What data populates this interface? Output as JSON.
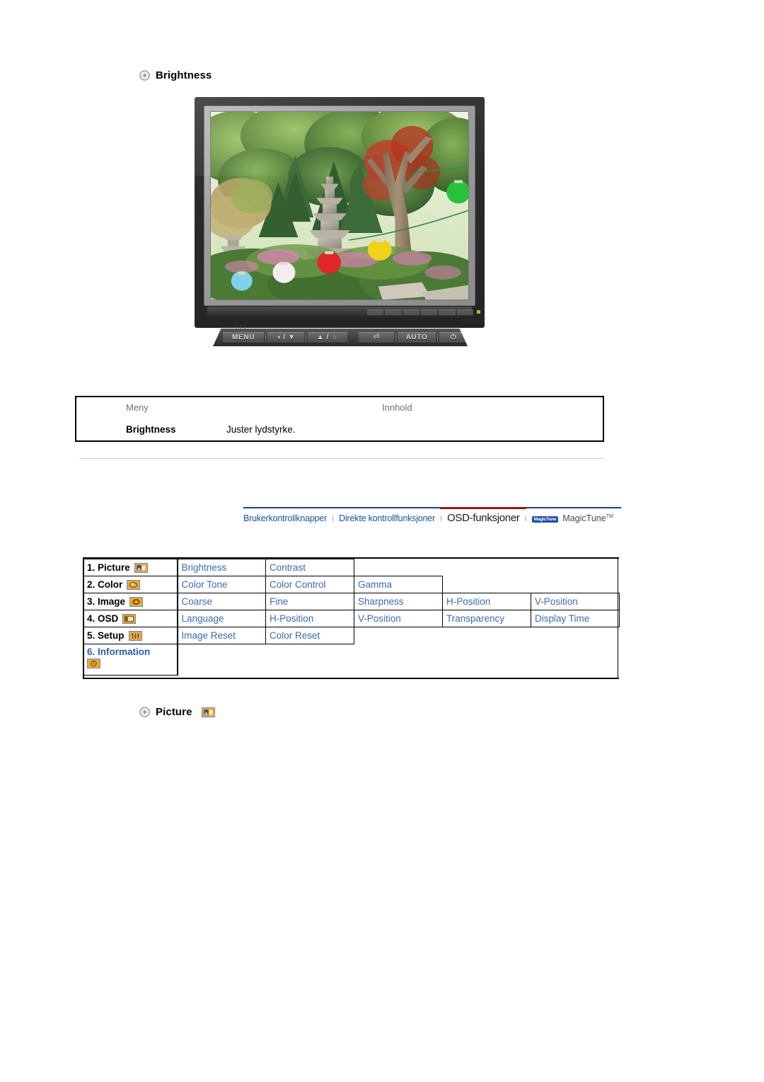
{
  "page": {
    "heading_brightness": "Brightness",
    "heading_picture": "Picture"
  },
  "monitor": {
    "controls": [
      {
        "name": "menu-button",
        "label": "MENU"
      },
      {
        "name": "brightness-down-button",
        "label": "◑ / ▼"
      },
      {
        "name": "brightness-up-button",
        "label": "▲ / ☼"
      },
      {
        "name": "enter-button",
        "label": "⏎"
      },
      {
        "name": "auto-button",
        "label": "AUTO"
      },
      {
        "name": "power-button",
        "label": "⏻"
      }
    ],
    "menu_mark": "|||"
  },
  "meny_table": {
    "headers": {
      "menu": "Meny",
      "content": "Innhold"
    },
    "rows": [
      {
        "menu": "Brightness",
        "content": "Juster lydstyrke."
      }
    ]
  },
  "tab_nav": {
    "items": [
      {
        "label": "Brukerkontrollknapper",
        "active": false
      },
      {
        "label": "Direkte kontrollfunksjoner",
        "active": false
      },
      {
        "label": "OSD-funksjoner",
        "active": true
      }
    ],
    "separator": "I",
    "magictune_badge": "MagicTune",
    "magictune_label": "MagicTune",
    "magictune_tm": "TM",
    "active_underline_color": "#9a1a1a",
    "rule_color": "#1f3f86",
    "link_color": "#17529e"
  },
  "osd_table": {
    "rows": [
      {
        "group": "1. Picture",
        "icon": "picture-icon",
        "items": [
          "Brightness",
          "Contrast"
        ]
      },
      {
        "group": "2. Color",
        "icon": "color-icon",
        "items": [
          "Color Tone",
          "Color Control",
          "Gamma"
        ]
      },
      {
        "group": "3. Image",
        "icon": "image-icon",
        "items": [
          "Coarse",
          "Fine",
          "Sharpness",
          "H-Position",
          "V-Position"
        ]
      },
      {
        "group": "4. OSD",
        "icon": "osd-icon",
        "items": [
          "Language",
          "H-Position",
          "V-Position",
          "Transparency",
          "Display Time"
        ]
      },
      {
        "group": "5. Setup",
        "icon": "setup-icon",
        "items": [
          "Image Reset",
          "Color Reset"
        ]
      },
      {
        "group": "6. Information",
        "icon": "information-icon",
        "items": []
      }
    ],
    "link_color": "#3b6bb0",
    "icon_color": "#f0a830"
  }
}
